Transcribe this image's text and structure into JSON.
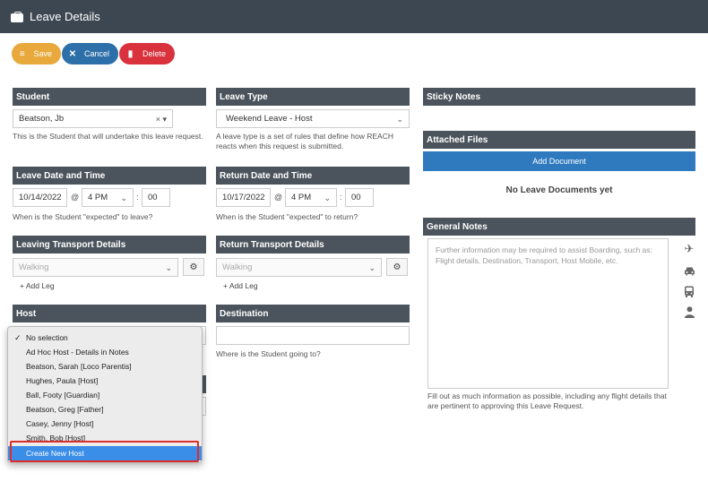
{
  "header": {
    "title": "Leave Details"
  },
  "toolbar": {
    "save": "Save",
    "cancel": "Cancel",
    "delete": "Delete"
  },
  "student": {
    "label": "Student",
    "value": "Beatson, Jb",
    "help": "This is the Student that will undertake this leave request."
  },
  "leave_type": {
    "label": "Leave Type",
    "value": "Weekend Leave - Host",
    "help": "A leave type is a set of rules that define how REACH reacts when this request is submitted."
  },
  "leave_date": {
    "label": "Leave Date and Time",
    "date": "10/14/2022",
    "at": "@",
    "hour": "4 PM",
    "colon": ":",
    "minute": "00",
    "help": "When is the Student \"expected\" to leave?"
  },
  "return_date": {
    "label": "Return Date and Time",
    "date": "10/17/2022",
    "at": "@",
    "hour": "4 PM",
    "colon": ":",
    "minute": "00",
    "help": "When is the Student \"expected\" to return?"
  },
  "leaving_transport": {
    "label": "Leaving Transport Details",
    "value": "Walking",
    "add_leg": "Add Leg"
  },
  "return_transport": {
    "label": "Return Transport Details",
    "value": "Walking",
    "add_leg": "Add Leg"
  },
  "host": {
    "label": "Host"
  },
  "destination": {
    "label": "Destination",
    "value": "",
    "help": "Where is the Student going to?"
  },
  "sticky_notes": {
    "label": "Sticky Notes"
  },
  "attached_files": {
    "label": "Attached Files",
    "add_button": "Add Document",
    "empty": "No Leave Documents yet"
  },
  "general_notes": {
    "label": "General Notes",
    "placeholder": "Further information may be required to assist Boarding, such as: Flight details, Destination, Transport, Host Mobile, etc.",
    "help": "Fill out as much information as possible, including any flight details that are pertinent to approving this Leave Request."
  },
  "host_dropdown": {
    "options": [
      "No selection",
      "Ad Hoc Host - Details in Notes",
      "Beatson, Sarah [Loco Parentis]",
      "Hughes, Paula [Host]",
      "Ball, Footy [Guardian]",
      "Beatson, Greg [Father]",
      "Casey, Jenny [Host]",
      "Smith, Bob [Host]",
      "Create New Host"
    ],
    "checked": "No selection",
    "highlighted": "Create New Host"
  },
  "colors": {
    "header": "#3d4752",
    "section": "#4b545d",
    "save": "#e8a83c",
    "cancel": "#2d6fa8",
    "delete": "#d9323d",
    "primary": "#2f7abf",
    "highlight_border": "#e02b2b"
  },
  "icons": [
    "briefcase-icon",
    "database-icon",
    "close-icon",
    "trash-icon",
    "gear-icon",
    "plus-icon",
    "plane-icon",
    "car-icon",
    "bus-icon",
    "person-icon"
  ]
}
